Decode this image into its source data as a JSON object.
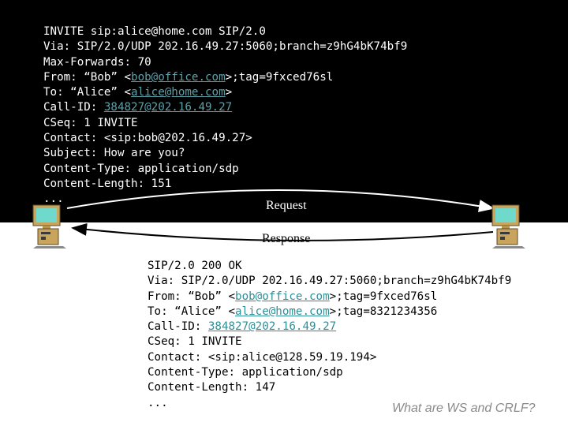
{
  "request": {
    "label": "Request",
    "lines": [
      {
        "text": "INVITE sip:alice@home.com SIP/2.0"
      },
      {
        "text": "Via: SIP/2.0/UDP 202.16.49.27:5060;branch=z9hG4bK74bf9"
      },
      {
        "text": "Max-Forwards: 70"
      },
      {
        "pre": "From: “Bob” <",
        "link": "bob@office.com",
        "post": ">;tag=9fxced76sl"
      },
      {
        "pre": "To: “Alice” <",
        "link": "alice@home.com",
        "post": ">"
      },
      {
        "pre": "Call-ID: ",
        "link": "384827@202.16.49.27",
        "post": ""
      },
      {
        "text": "CSeq: 1 INVITE"
      },
      {
        "text": "Contact: <sip:bob@202.16.49.27>"
      },
      {
        "text": "Subject: How are you?"
      },
      {
        "text": "Content-Type: application/sdp"
      },
      {
        "text": "Content-Length: 151"
      },
      {
        "text": "..."
      }
    ]
  },
  "response": {
    "label": "Response",
    "lines": [
      {
        "text": "SIP/2.0 200 OK"
      },
      {
        "text": "Via: SIP/2.0/UDP 202.16.49.27:5060;branch=z9hG4bK74bf9"
      },
      {
        "pre": "From: “Bob” <",
        "link": "bob@office.com",
        "post": ">;tag=9fxced76sl"
      },
      {
        "pre": "To: “Alice” <",
        "link": "alice@home.com",
        "post": ">;tag=8321234356"
      },
      {
        "pre": "Call-ID: ",
        "link": "384827@202.16.49.27",
        "post": ""
      },
      {
        "text": "CSeq: 1 INVITE"
      },
      {
        "text": "Contact: <sip:alice@128.59.19.194>"
      },
      {
        "text": "Content-Type: application/sdp"
      },
      {
        "text": "Content-Length: 147"
      },
      {
        "text": "..."
      }
    ]
  },
  "footer": {
    "question": "What are WS and CRLF?"
  },
  "icons": {
    "left_host": "computer-icon",
    "right_host": "computer-icon"
  },
  "colors": {
    "band": "#000000",
    "link": "#2f8f96",
    "question": "#8a8a8a"
  }
}
